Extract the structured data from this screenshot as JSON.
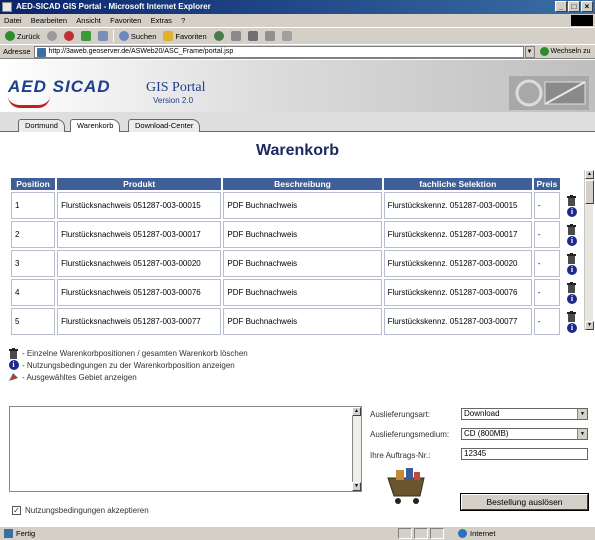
{
  "window": {
    "title": "AED-SICAD GIS Portal - Microsoft Internet Explorer",
    "controls": [
      "_",
      "□",
      "×"
    ]
  },
  "menu": [
    "Datei",
    "Bearbeiten",
    "Ansicht",
    "Favoriten",
    "Extras",
    "?"
  ],
  "toolbar": {
    "back": "Zurück",
    "search": "Suchen",
    "favorites": "Favoriten"
  },
  "address": {
    "label": "Adresse",
    "url": "http://3aweb.geoserver.de/ASWeb20/ASC_Frame/portal.jsp",
    "go": "Wechseln zu"
  },
  "header": {
    "logo_main_a": "AED",
    "logo_main_b": "SICAD",
    "portal_title": "GIS Portal",
    "version": "Version 2.0"
  },
  "tabs": [
    "Dortmund",
    "Warenkorb",
    "Download-Center"
  ],
  "page_title": "Warenkorb",
  "table": {
    "headers": [
      "Position",
      "Produkt",
      "Beschreibung",
      "fachliche Selektion",
      "Preis"
    ],
    "rows": [
      {
        "pos": "1",
        "produkt": "Flurstücksnachweis 051287-003-00015",
        "beschreibung": "PDF Buchnachweis",
        "selektion": "Flurstückskennz. 051287-003-00015",
        "preis": "-"
      },
      {
        "pos": "2",
        "produkt": "Flurstücksnachweis 051287-003-00017",
        "beschreibung": "PDF Buchnachweis",
        "selektion": "Flurstückskennz. 051287-003-00017",
        "preis": "-"
      },
      {
        "pos": "3",
        "produkt": "Flurstücksnachweis 051287-003-00020",
        "beschreibung": "PDF Buchnachweis",
        "selektion": "Flurstückskennz. 051287-003-00020",
        "preis": "-"
      },
      {
        "pos": "4",
        "produkt": "Flurstücksnachweis 051287-003-00076",
        "beschreibung": "PDF Buchnachweis",
        "selektion": "Flurstückskennz. 051287-003-00076",
        "preis": "-"
      },
      {
        "pos": "5",
        "produkt": "Flurstücksnachweis 051287-003-00077",
        "beschreibung": "PDF Buchnachweis",
        "selektion": "Flurstückskennz. 051287-003-00077",
        "preis": "-"
      }
    ]
  },
  "legend": {
    "delete": "- Einzelne Warenkorbpositionen / gesamten Warenkorb löschen",
    "info": "- Nutzungsbedingungen zu der Warenkorbposition anzeigen",
    "area": "- Ausgewähltes Gebiet anzeigen"
  },
  "form": {
    "delivery_type_label": "Auslieferungsart:",
    "delivery_type_value": "Download",
    "medium_label": "Auslieferungsmedium:",
    "medium_value": "CD (800MB)",
    "order_no_label": "Ihre Auftrags-Nr.:",
    "order_no_value": "12345",
    "submit": "Bestellung auslösen"
  },
  "accept_label": "Nutzungsbedingungen akzeptieren",
  "status": {
    "text": "Fertig",
    "zone": "Internet"
  },
  "colors": {
    "table_header": "#3e5f97",
    "title": "#1b2a5e",
    "brand_blue": "#1d3f8a",
    "brand_red": "#c41e1e"
  }
}
